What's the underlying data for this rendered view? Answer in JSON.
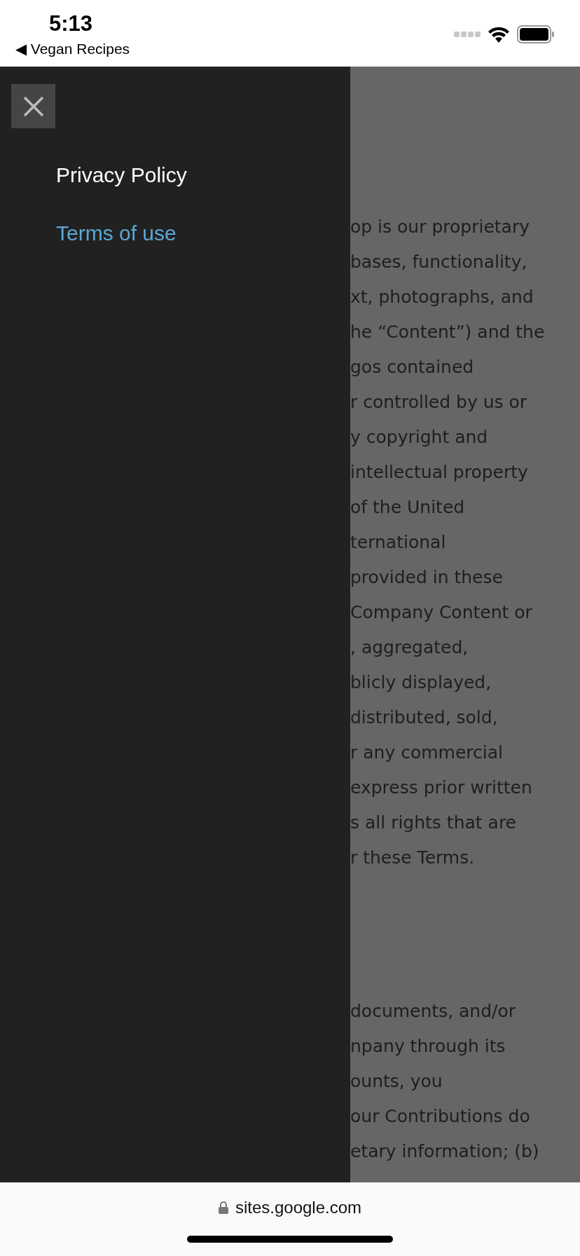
{
  "status_bar": {
    "time": "5:13",
    "back_label": "◀ Vegan Recipes"
  },
  "drawer": {
    "items": [
      {
        "label": "Privacy Policy",
        "selected": false
      },
      {
        "label": "Terms of use",
        "selected": true
      }
    ]
  },
  "page_text": {
    "paragraphs": [
      [
        "op is our proprietary",
        "bases, functionality,",
        "xt, photographs, and",
        "he “Content”) and the",
        "gos contained",
        "r controlled by us or",
        "y copyright and",
        "intellectual property",
        "of the United",
        "ternational",
        "provided in these",
        "Company Content or",
        ", aggregated,",
        "blicly displayed,",
        "distributed, sold,",
        "r any commercial",
        "express prior written",
        "s all rights that are",
        "r these Terms."
      ],
      [
        "documents, and/or",
        "npany through its",
        "ounts, you",
        "our Contributions do",
        "etary information; (b)"
      ]
    ]
  },
  "address_bar": {
    "url": "sites.google.com"
  }
}
